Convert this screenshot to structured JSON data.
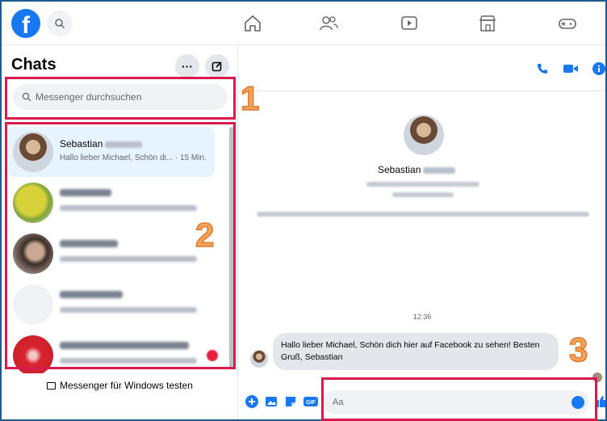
{
  "nav": {
    "logo": "f",
    "search_icon": "search-icon",
    "icons": [
      "home-icon",
      "friends-icon",
      "watch-icon",
      "marketplace-icon",
      "gaming-icon"
    ]
  },
  "sidebar": {
    "title": "Chats",
    "more_label": "···",
    "search_placeholder": "Messenger durchsuchen",
    "chats": [
      {
        "name": "Sebastian",
        "snippet": "Hallo lieber Michael, Schön di... · 15 Min.",
        "active": true
      }
    ],
    "windows_button": "Messenger für Windows testen"
  },
  "conversation": {
    "profile_name": "Sebastian",
    "timestamp": "12:36",
    "message": "Hallo lieber Michael, Schön dich hier auf Facebook zu sehen! Besten Gruß, Sebastian",
    "input_placeholder": "Aa"
  },
  "annotations": {
    "one": "1",
    "two": "2",
    "three": "3"
  },
  "colors": {
    "brand": "#1877f2",
    "highlight": "#d81b4f",
    "number": "#f5a35c",
    "active_chat": "#e7f3ff"
  }
}
